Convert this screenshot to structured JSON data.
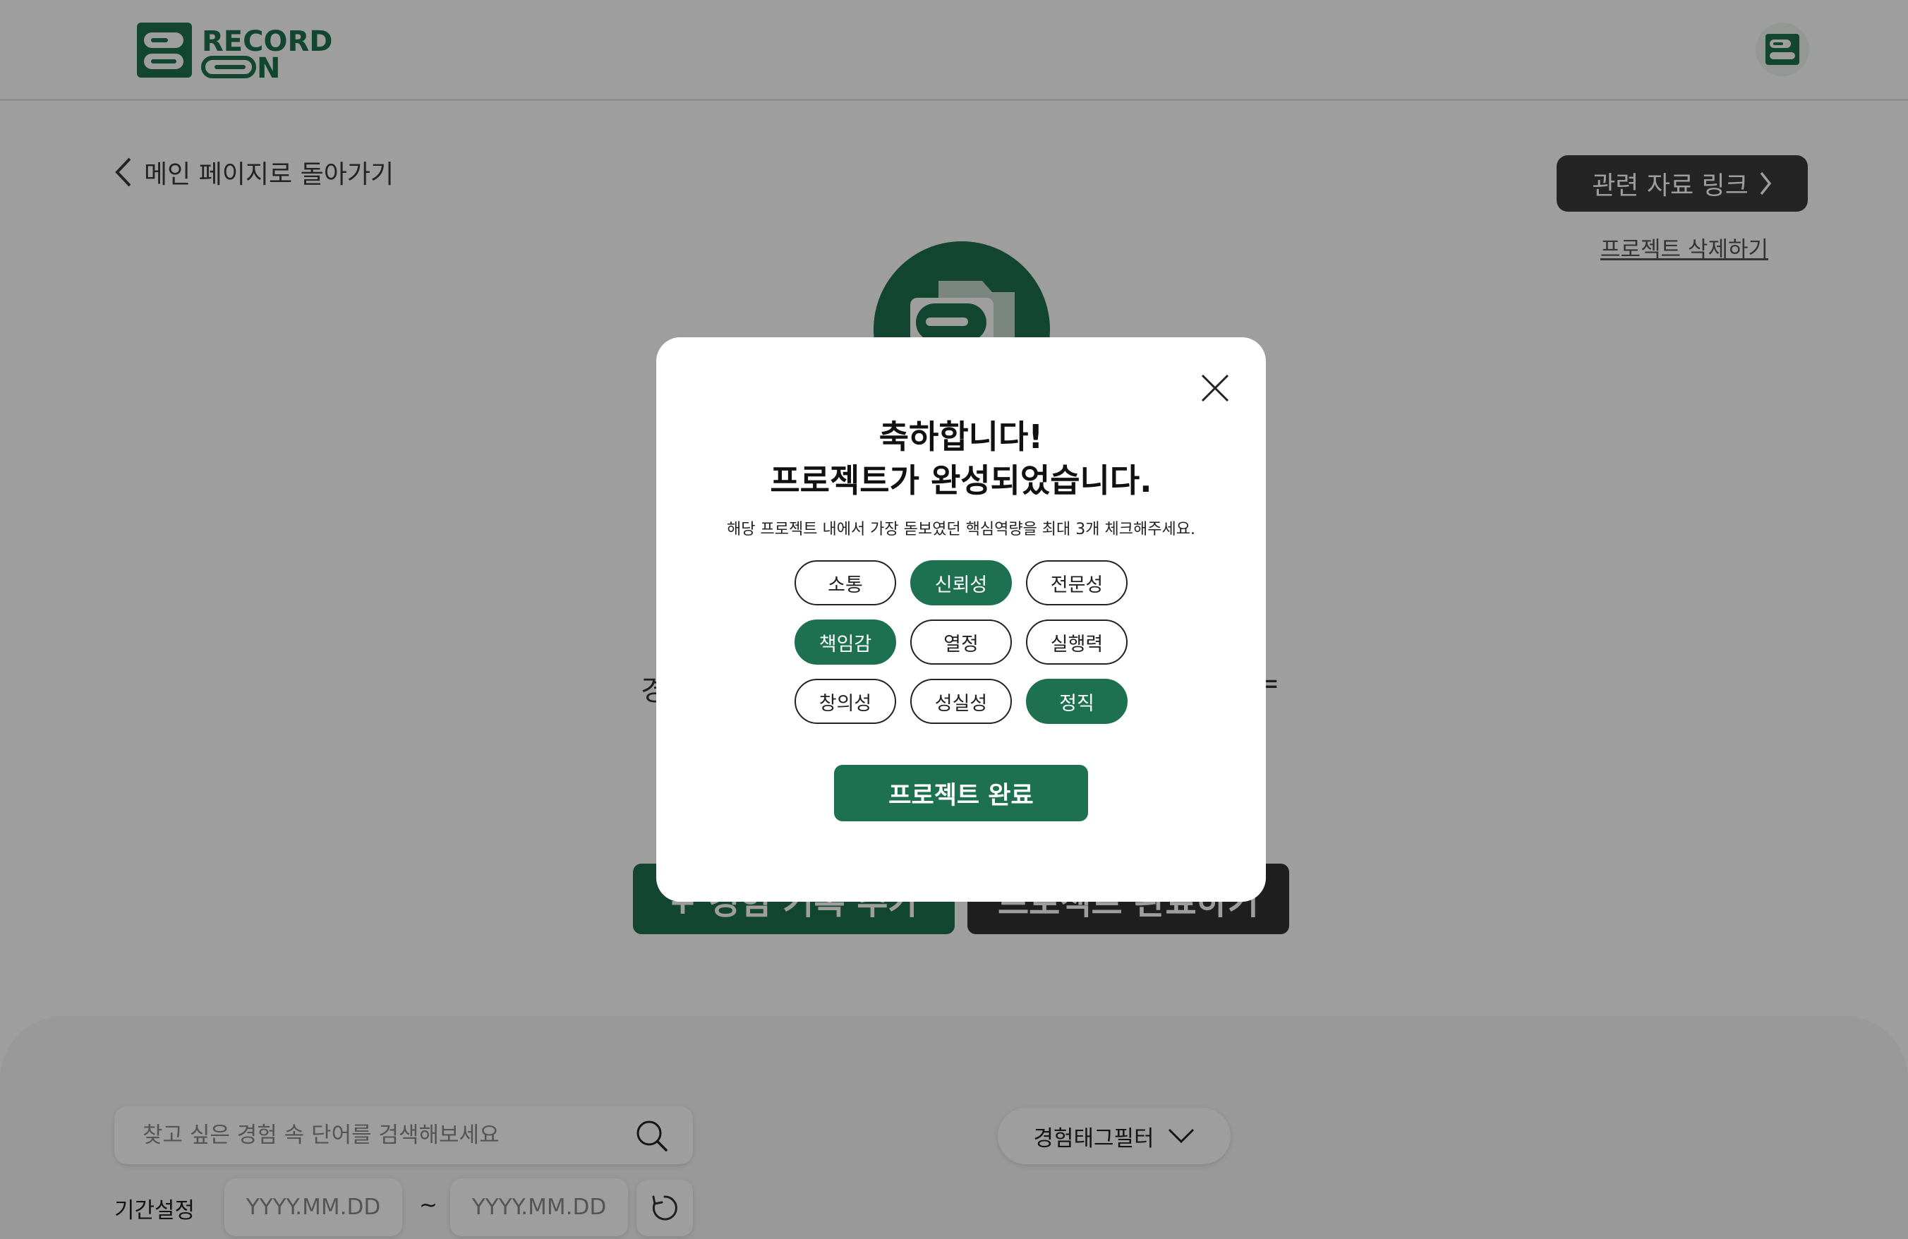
{
  "brand": {
    "logo_text_line1": "RECORD",
    "logo_text_line2": "N",
    "primary_color": "#1e7150",
    "dark_color": "#333333"
  },
  "header": {
    "avatar_icon": "folder-icon"
  },
  "nav": {
    "back_label": "메인 페이지로 돌아가기",
    "back_icon": "chevron-left-icon"
  },
  "actions": {
    "resource_link_label": "관련 자료 링크",
    "resource_link_icon": "chevron-right-icon",
    "delete_project_label": "프로젝트 삭제하기"
  },
  "background": {
    "description_left": "경",
    "description_right": "=",
    "add_experience_label": "+ 경험 기록 추가",
    "complete_project_label": "프로젝트 완료하기"
  },
  "filters": {
    "search_placeholder": "찾고 싶은 경험 속 단어를 검색해보세요",
    "tag_filter_label": "경험태그필터",
    "period_label": "기간설정",
    "date_start_placeholder": "YYYY.MM.DD",
    "date_end_placeholder": "YYYY.MM.DD",
    "date_separator": "~"
  },
  "modal": {
    "title_line1": "축하합니다!",
    "title_line2": "프로젝트가 완성되었습니다.",
    "subtitle": "해당 프로젝트 내에서 가장 돋보였던 핵심역량을 최대 3개 체크해주세요.",
    "competencies": [
      {
        "label": "소통",
        "selected": false
      },
      {
        "label": "신뢰성",
        "selected": true
      },
      {
        "label": "전문성",
        "selected": false
      },
      {
        "label": "책임감",
        "selected": true
      },
      {
        "label": "열정",
        "selected": false
      },
      {
        "label": "실행력",
        "selected": false
      },
      {
        "label": "창의성",
        "selected": false
      },
      {
        "label": "성실성",
        "selected": false
      },
      {
        "label": "정직",
        "selected": true
      }
    ],
    "complete_label": "프로젝트 완료"
  }
}
